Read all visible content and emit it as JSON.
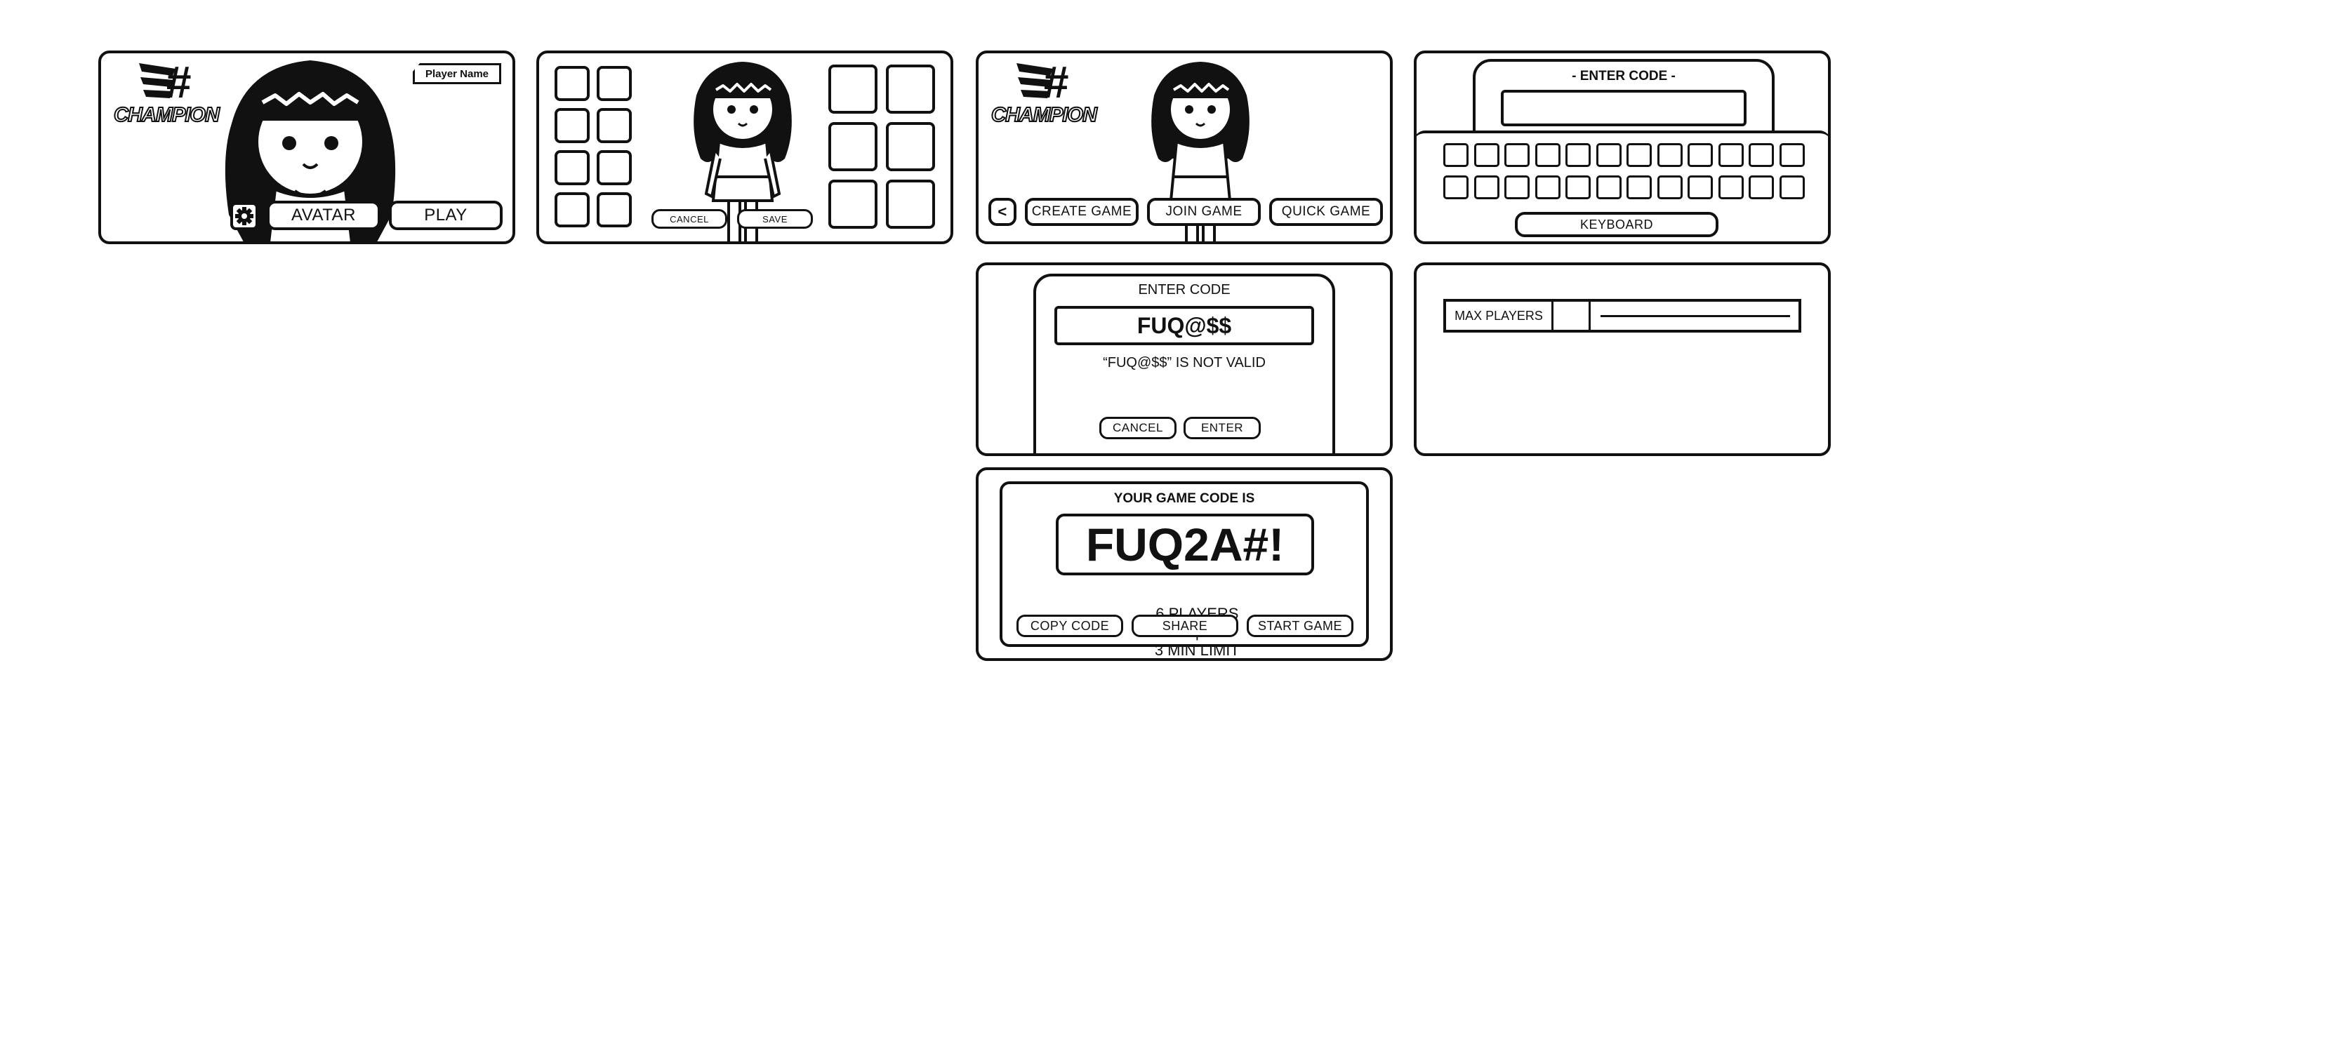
{
  "screen_home": {
    "logo_mark": "#",
    "logo_text": "CHAMPION",
    "player_name_tag": "Player Name",
    "avatar_button": "AVATAR",
    "play_button": "PLAY",
    "settings_icon": "gear-icon"
  },
  "screen_avatar_editor": {
    "cancel_button": "CANCEL",
    "save_button": "SAVE"
  },
  "screen_play_menu": {
    "logo_mark": "#",
    "logo_text": "CHAMPION",
    "back_button": "<",
    "create_game_button": "CREATE GAME",
    "join_game_button": "JOIN GAME",
    "quick_game_button": "QUICK GAME"
  },
  "screen_keyboard": {
    "title": "- ENTER CODE -",
    "code_value": "",
    "keyboard_label": "KEYBOARD"
  },
  "screen_invalid_code": {
    "title": "ENTER CODE",
    "code_value": "FUQ@$$",
    "error_message": "“FUQ@$$” IS NOT VALID",
    "cancel_button": "CANCEL",
    "enter_button": "ENTER"
  },
  "screen_create_settings": {
    "max_players_label": "MAX PLAYERS",
    "max_players_value": ""
  },
  "screen_game_code": {
    "heading": "YOUR GAME CODE IS",
    "code_value": "FUQ2A#!",
    "players": "6 PLAYERS",
    "separator": "|",
    "time_limit": "3 MIN LIMIT",
    "copy_code_button": "COPY CODE",
    "share_button": "SHARE",
    "start_game_button": "START GAME"
  }
}
